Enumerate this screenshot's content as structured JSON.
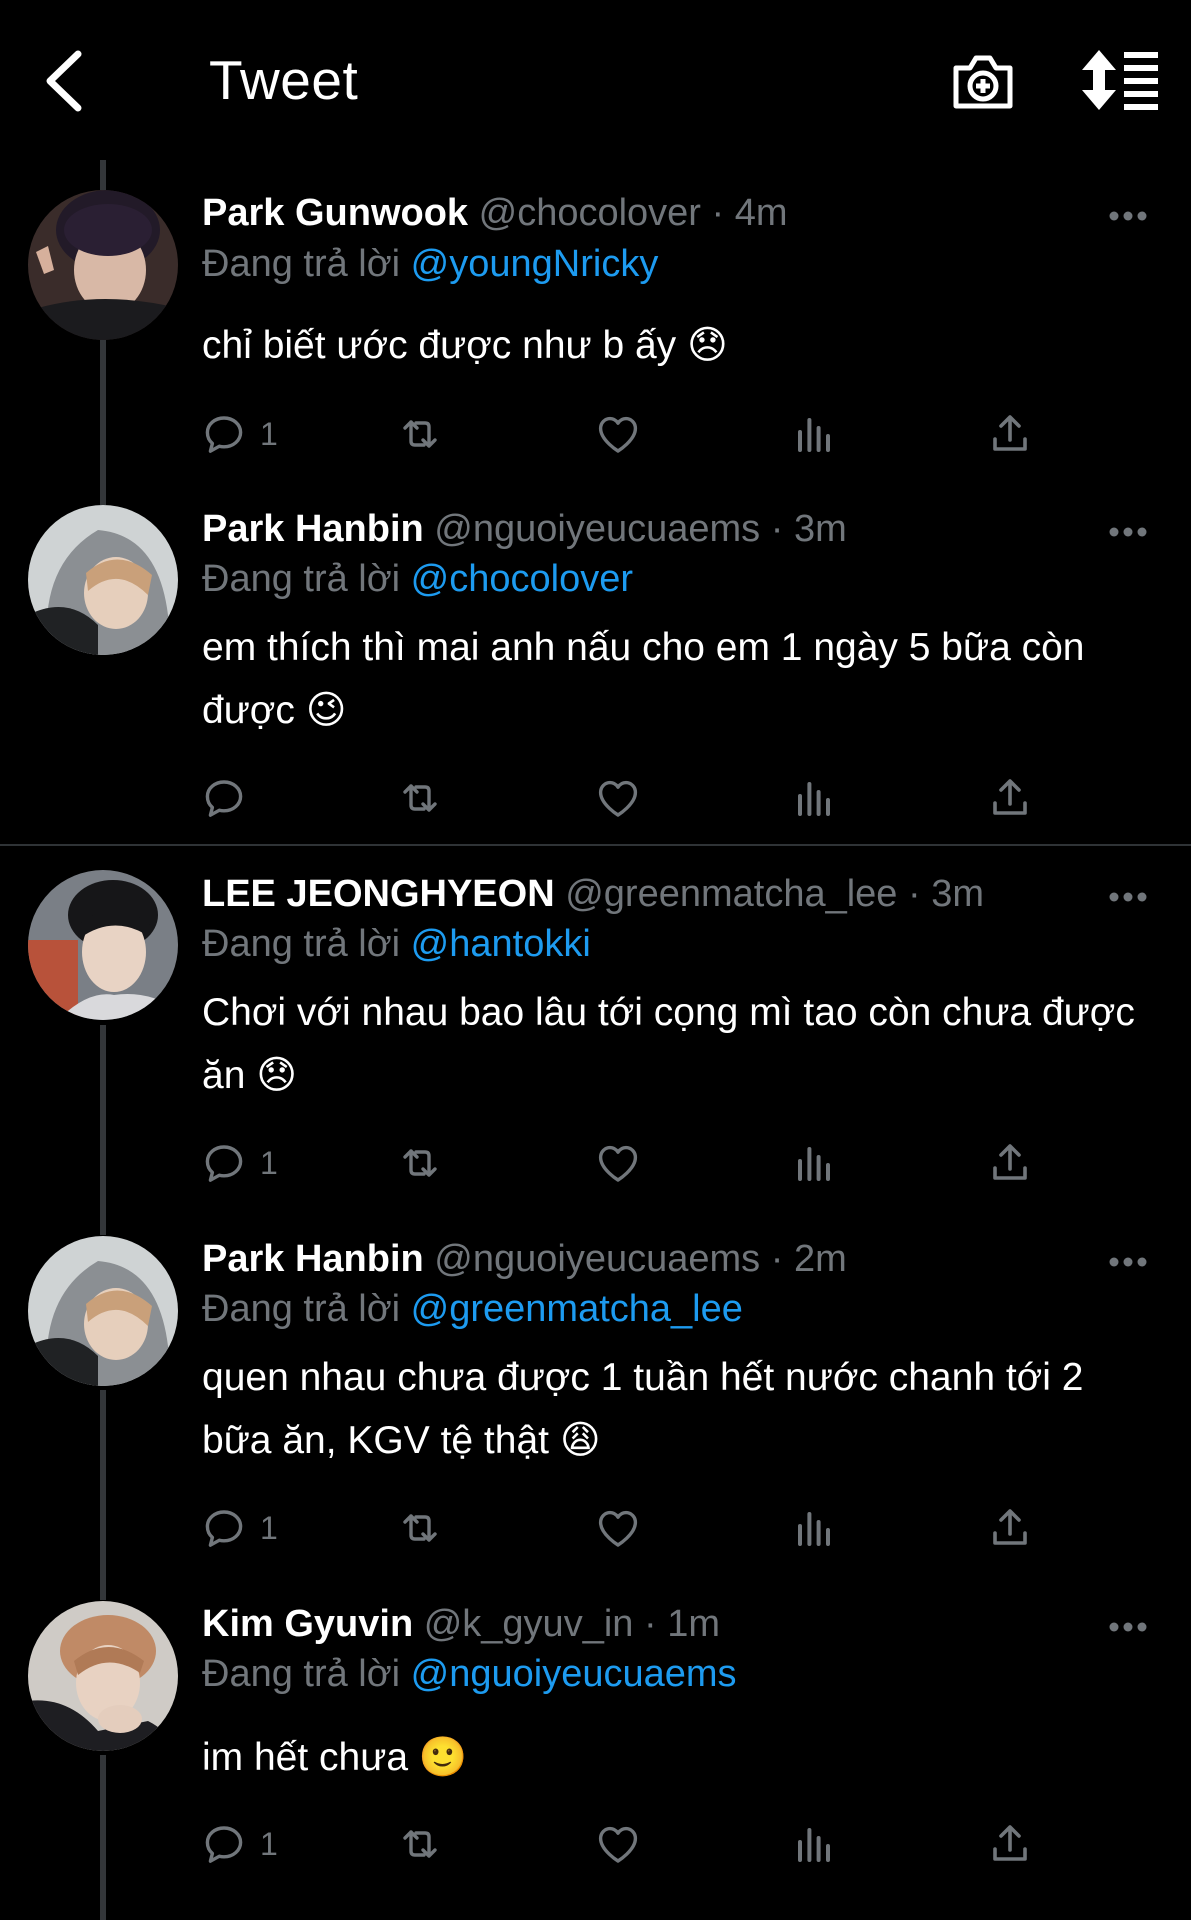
{
  "header": {
    "title": "Tweet",
    "back_icon": "chevron-left-icon",
    "camera_icon": "camera-plus-icon",
    "sort_icon": "sort-list-icon"
  },
  "colors": {
    "background": "#000000",
    "primary_text": "#e7e9ea",
    "secondary_text": "#71767b",
    "link": "#1d9bf0"
  },
  "tweets": [
    {
      "name": "Park Gunwook",
      "handle": "@chocolover",
      "time": "4m",
      "reply_prefix": "Đang trả lời",
      "reply_to": "@youngNricky",
      "text": "chỉ biết ước được như b ấy 😞",
      "reply_count": "1"
    },
    {
      "name": "Park Hanbin",
      "handle": "@nguoiyeucuaems",
      "time": "3m",
      "reply_prefix": "Đang trả lời",
      "reply_to": "@chocolover",
      "text": "em thích thì mai anh nấu cho em 1 ngày 5 bữa còn được 😉",
      "reply_count": ""
    },
    {
      "name": "LEE JEONGHYEON",
      "handle": "@greenmatcha_lee",
      "time": "3m",
      "reply_prefix": "Đang trả lời",
      "reply_to": "@hantokki",
      "text": "Chơi với nhau bao lâu tới cọng mì tao còn chưa được ăn 😞",
      "reply_count": "1"
    },
    {
      "name": "Park Hanbin",
      "handle": "@nguoiyeucuaems",
      "time": "2m",
      "reply_prefix": "Đang trả lời",
      "reply_to": "@greenmatcha_lee",
      "text": "quen nhau chưa được 1 tuần hết nước chanh tới 2 bữa ăn, KGV tệ thật 😩",
      "reply_count": "1"
    },
    {
      "name": "Kim Gyuvin",
      "handle": "@k_gyuv_in",
      "time": "1m",
      "reply_prefix": "Đang trả lời",
      "reply_to": "@nguoiyeucuaems",
      "text": "im hết chưa 🙂",
      "reply_count": "1"
    }
  ]
}
